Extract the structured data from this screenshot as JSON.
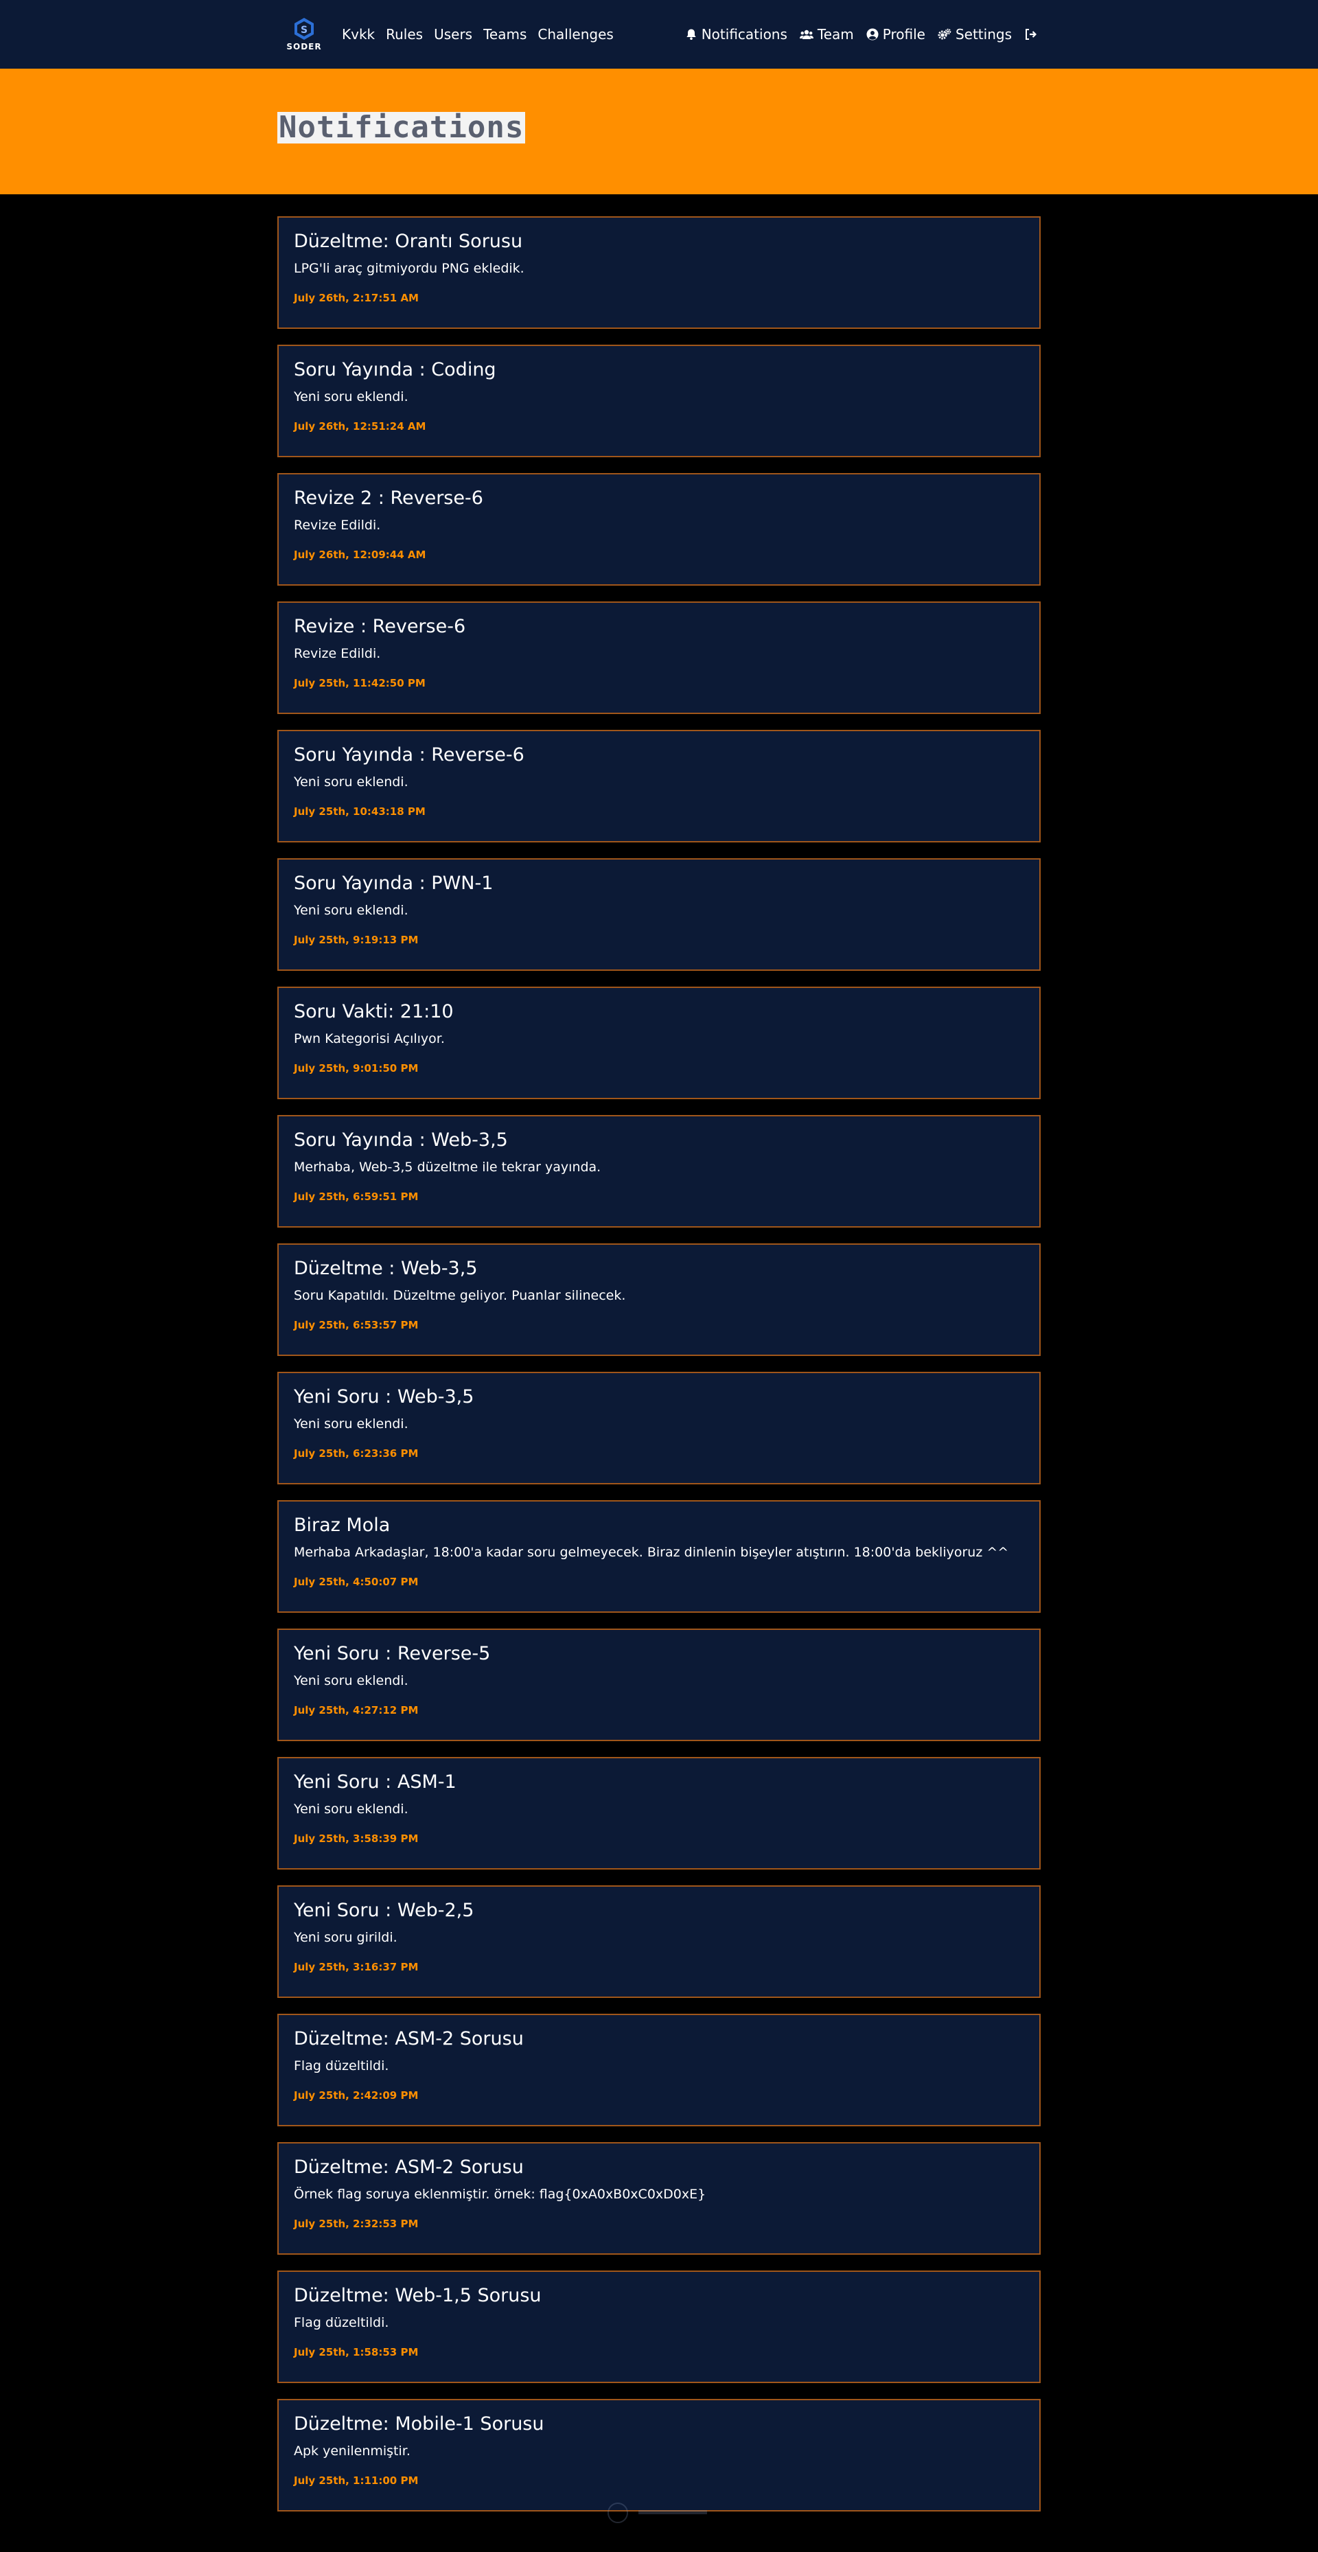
{
  "brand": {
    "name": "SODER",
    "logo_icon": "soder-logo-icon"
  },
  "nav": {
    "left": [
      {
        "label": "Kvkk"
      },
      {
        "label": "Rules"
      },
      {
        "label": "Users"
      },
      {
        "label": "Teams"
      },
      {
        "label": "Challenges"
      }
    ],
    "right": [
      {
        "label": "Notifications",
        "icon": "bell-icon"
      },
      {
        "label": "Team",
        "icon": "users-icon"
      },
      {
        "label": "Profile",
        "icon": "user-circle-icon"
      },
      {
        "label": "Settings",
        "icon": "gears-icon"
      },
      {
        "label": "",
        "icon": "sign-out-icon"
      }
    ]
  },
  "page": {
    "title": "Notifications"
  },
  "colors": {
    "navbar_bg": "#0c1a36",
    "accent": "#ff8f00",
    "card_border": "#a0561a",
    "page_bg": "#000000"
  },
  "notifications": [
    {
      "title": "Düzeltme: Orantı Sorusu",
      "body": "LPG'li araç gitmiyordu PNG ekledik.",
      "time": "July 26th, 2:17:51 AM"
    },
    {
      "title": "Soru Yayında : Coding",
      "body": "Yeni soru eklendi.",
      "time": "July 26th, 12:51:24 AM"
    },
    {
      "title": "Revize 2 : Reverse-6",
      "body": "Revize Edildi.",
      "time": "July 26th, 12:09:44 AM"
    },
    {
      "title": "Revize : Reverse-6",
      "body": "Revize Edildi.",
      "time": "July 25th, 11:42:50 PM"
    },
    {
      "title": "Soru Yayında : Reverse-6",
      "body": "Yeni soru eklendi.",
      "time": "July 25th, 10:43:18 PM"
    },
    {
      "title": "Soru Yayında : PWN-1",
      "body": "Yeni soru eklendi.",
      "time": "July 25th, 9:19:13 PM"
    },
    {
      "title": "Soru Vakti: 21:10",
      "body": "Pwn Kategorisi Açılıyor.",
      "time": "July 25th, 9:01:50 PM"
    },
    {
      "title": "Soru Yayında : Web-3,5",
      "body": "Merhaba, Web-3,5 düzeltme ile tekrar yayında.",
      "time": "July 25th, 6:59:51 PM"
    },
    {
      "title": "Düzeltme : Web-3,5",
      "body": "Soru Kapatıldı. Düzeltme geliyor. Puanlar silinecek.",
      "time": "July 25th, 6:53:57 PM"
    },
    {
      "title": "Yeni Soru : Web-3,5",
      "body": "Yeni soru eklendi.",
      "time": "July 25th, 6:23:36 PM"
    },
    {
      "title": "Biraz Mola",
      "body": "Merhaba Arkadaşlar, 18:00'a kadar soru gelmeyecek. Biraz dinlenin bişeyler atıştırın. 18:00'da bekliyoruz ^^",
      "time": "July 25th, 4:50:07 PM"
    },
    {
      "title": "Yeni Soru : Reverse-5",
      "body": "Yeni soru eklendi.",
      "time": "July 25th, 4:27:12 PM"
    },
    {
      "title": "Yeni Soru : ASM-1",
      "body": "Yeni soru eklendi.",
      "time": "July 25th, 3:58:39 PM"
    },
    {
      "title": "Yeni Soru : Web-2,5",
      "body": "Yeni soru girildi.",
      "time": "July 25th, 3:16:37 PM"
    },
    {
      "title": "Düzeltme: ASM-2 Sorusu",
      "body": "Flag düzeltildi.",
      "time": "July 25th, 2:42:09 PM"
    },
    {
      "title": "Düzeltme: ASM-2 Sorusu",
      "body": "Örnek flag soruya eklenmiştir. örnek: flag{0xA0xB0xC0xD0xE}",
      "time": "July 25th, 2:32:53 PM"
    },
    {
      "title": "Düzeltme: Web-1,5 Sorusu",
      "body": "Flag düzeltildi.",
      "time": "July 25th, 1:58:53 PM"
    },
    {
      "title": "Düzeltme: Mobile-1 Sorusu",
      "body": "Apk yenilenmiştir.",
      "time": "July 25th, 1:11:00 PM"
    }
  ]
}
